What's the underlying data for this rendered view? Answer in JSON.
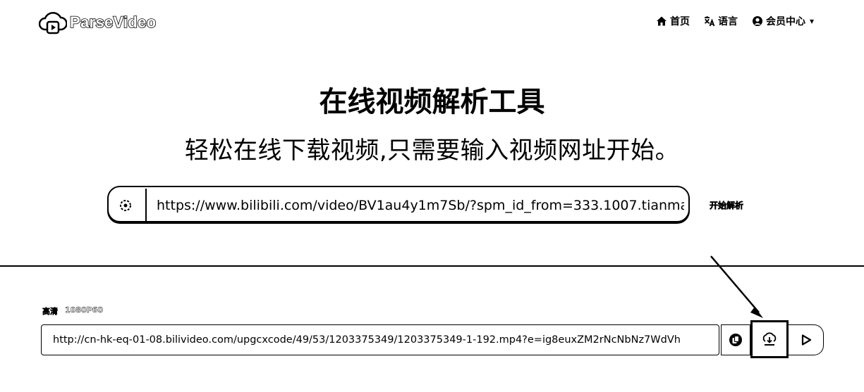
{
  "header": {
    "brand": "ParseVideo",
    "nav": [
      {
        "label": "首页",
        "icon": "home-icon"
      },
      {
        "label": "语言",
        "icon": "translate-icon"
      },
      {
        "label": "会员中心",
        "icon": "user-icon"
      }
    ]
  },
  "hero": {
    "title": "在线视频解析工具",
    "subtitle": "轻松在线下载视频,只需要输入视频网址开始。"
  },
  "search": {
    "url_value": "https://www.bilibili.com/video/BV1au4y1m7Sb/?spm_id_from=333.1007.tianma",
    "clipboard_icon": "clipboard-paste-icon",
    "parse_label": "开始解析"
  },
  "result": {
    "quality_label": "高清",
    "resolution": "1080P60",
    "url_value": "http://cn-hk-eq-01-08.bilivideo.com/upgcxcode/49/53/1203375349/1203375349-1-192.mp4?e=ig8euxZM2rNcNbNz7WdVh",
    "actions": [
      {
        "icon": "copy-icon"
      },
      {
        "icon": "download-icon"
      },
      {
        "icon": "play-icon"
      }
    ]
  }
}
